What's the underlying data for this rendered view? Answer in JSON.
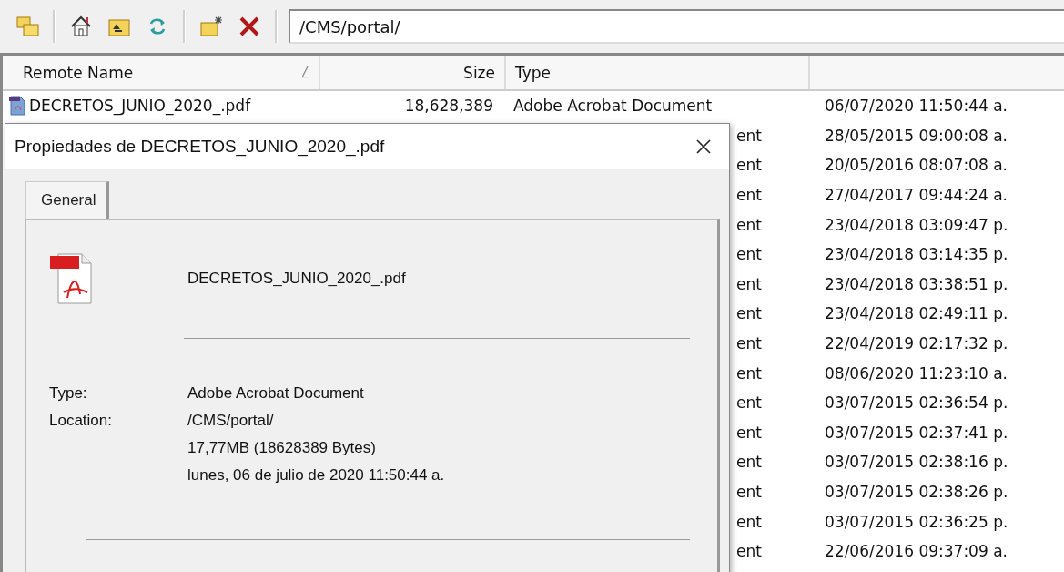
{
  "toolbar": {
    "path": "/CMS/portal/"
  },
  "table": {
    "columns": [
      {
        "label": "Remote Name",
        "sorted": true
      },
      {
        "label": "Size",
        "sorted": false
      },
      {
        "label": "Type",
        "sorted": false
      }
    ],
    "rows": [
      {
        "kind": "full",
        "name": "DECRETOS_JUNIO_2020_.pdf",
        "size": "18,628,389",
        "type": "Adobe Acrobat Document",
        "date": "06/07/2020 11:50:44 a."
      },
      {
        "kind": "covered",
        "type": "ent",
        "date": "28/05/2015 09:00:08 a."
      },
      {
        "kind": "covered",
        "type": "ent",
        "date": "20/05/2016 08:07:08 a."
      },
      {
        "kind": "covered",
        "type": "ent",
        "date": "27/04/2017 09:44:24 a."
      },
      {
        "kind": "covered",
        "type": "ent",
        "date": "23/04/2018 03:09:47 p."
      },
      {
        "kind": "covered",
        "type": "ent",
        "date": "23/04/2018 03:14:35 p."
      },
      {
        "kind": "covered",
        "type": "ent",
        "date": "23/04/2018 03:38:51 p."
      },
      {
        "kind": "covered",
        "type": "ent",
        "date": "23/04/2018 02:49:11 p."
      },
      {
        "kind": "covered",
        "type": "ent",
        "date": "22/04/2019 02:17:32 p."
      },
      {
        "kind": "covered",
        "type": "ent",
        "date": "08/06/2020 11:23:10 a."
      },
      {
        "kind": "covered",
        "type": "ent",
        "date": "03/07/2015 02:36:54 p."
      },
      {
        "kind": "covered",
        "type": "ent",
        "date": "03/07/2015 02:37:41 p."
      },
      {
        "kind": "covered",
        "type": "ent",
        "date": "03/07/2015 02:38:16 p."
      },
      {
        "kind": "covered",
        "type": "ent",
        "date": "03/07/2015 02:38:26 p."
      },
      {
        "kind": "covered",
        "type": "ent",
        "date": "03/07/2015 02:36:25 p."
      },
      {
        "kind": "covered",
        "type": "ent",
        "date": "22/06/2016 09:37:09 a."
      }
    ]
  },
  "dialog": {
    "title": "Propiedades de DECRETOS_JUNIO_2020_.pdf",
    "tabs": [
      {
        "label": "General",
        "selected": true
      }
    ],
    "file_name": "DECRETOS_JUNIO_2020_.pdf",
    "properties": [
      {
        "label": "Type:",
        "value": "Adobe Acrobat Document"
      },
      {
        "label": "Location:",
        "value": "/CMS/portal/"
      },
      {
        "value": "17,77MB (18628389 Bytes)"
      },
      {
        "value": "lunes, 06 de julio de 2020 11:50:44 a."
      }
    ]
  }
}
